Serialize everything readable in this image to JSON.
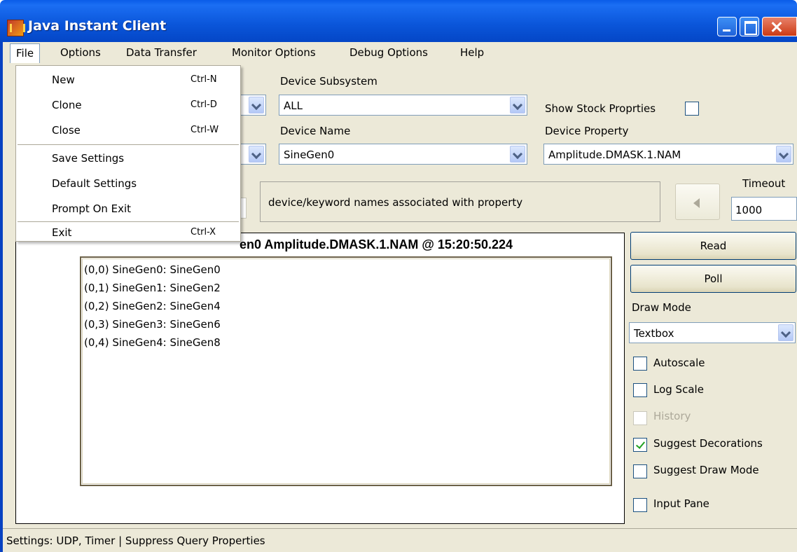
{
  "window": {
    "title": "Java Instant Client"
  },
  "menu": {
    "items": [
      "File",
      "Options",
      "Data Transfer",
      "Monitor Options",
      "Debug Options",
      "Help"
    ]
  },
  "file_menu": {
    "items": [
      {
        "label": "New",
        "shortcut": "Ctrl-N"
      },
      {
        "label": "Clone",
        "shortcut": "Ctrl-D"
      },
      {
        "label": "Close",
        "shortcut": "Ctrl-W"
      },
      {
        "label": "Save Settings",
        "shortcut": ""
      },
      {
        "label": "Default Settings",
        "shortcut": ""
      },
      {
        "label": "Prompt On Exit",
        "shortcut": ""
      },
      {
        "label": "Exit",
        "shortcut": "Ctrl-X"
      }
    ]
  },
  "form": {
    "subsystem_label": "Device Subsystem",
    "subsystem_value": "ALL",
    "show_stock_label": "Show Stock Proprties",
    "device_name_label": "Device Name",
    "device_name_value": "SineGen0",
    "device_property_label": "Device Property",
    "device_property_value": "Amplitude.DMASK.1.NAM",
    "description": "device/keyword names associated with property",
    "timeout_label": "Timeout",
    "timeout_value": "1000"
  },
  "display": {
    "title": "en0 Amplitude.DMASK.1.NAM @ 15:20:50.224",
    "lines": [
      "(0,0)  SineGen0: SineGen0",
      "(0,1)  SineGen1: SineGen2",
      "(0,2)  SineGen2: SineGen4",
      "(0,3)  SineGen3: SineGen6",
      "(0,4)  SineGen4: SineGen8"
    ]
  },
  "controls": {
    "read_label": "Read",
    "poll_label": "Poll",
    "draw_mode_label": "Draw Mode",
    "draw_mode_value": "Textbox",
    "autoscale_label": "Autoscale",
    "autoscale_checked": false,
    "log_scale_label": "Log Scale",
    "log_scale_checked": false,
    "history_label": "History",
    "history_enabled": false,
    "suggest_decorations_label": "Suggest Decorations",
    "suggest_decorations_checked": true,
    "suggest_draw_mode_label": "Suggest Draw Mode",
    "suggest_draw_mode_checked": false,
    "input_pane_label": "Input Pane",
    "input_pane_checked": false
  },
  "status": {
    "text": "Settings: UDP, Timer | Suppress Query Properties"
  },
  "colors": {
    "title_bar": "#0a55d9",
    "window_bg": "#ece9d8",
    "disabled_text": "#aca899"
  }
}
